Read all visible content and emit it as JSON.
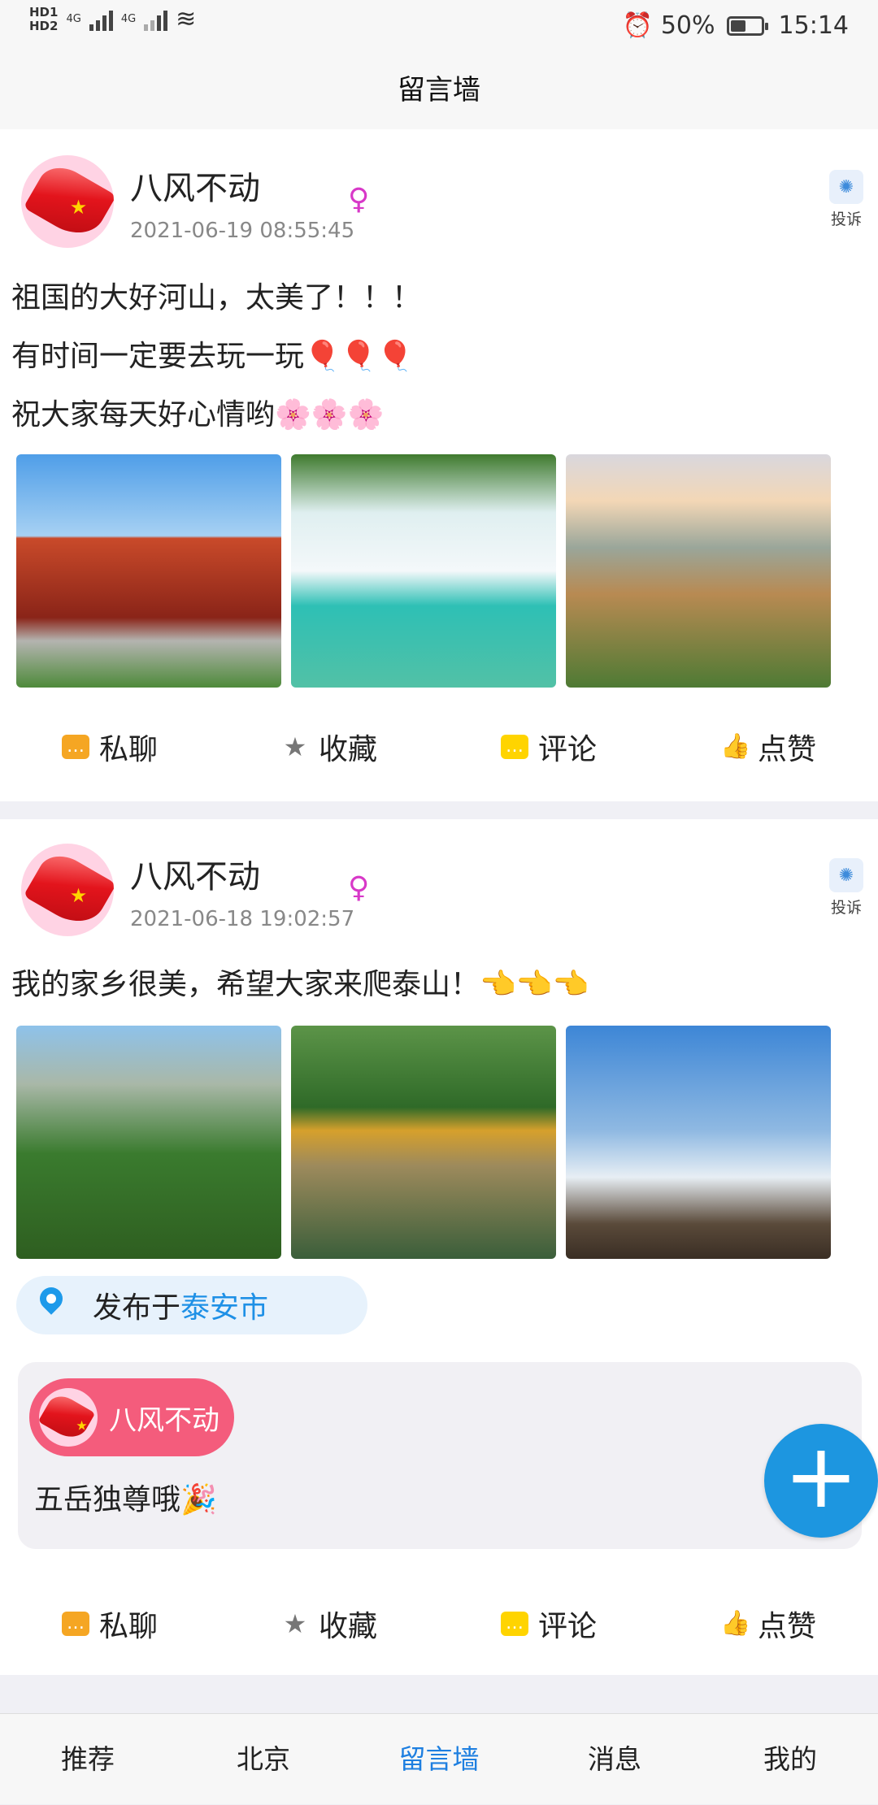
{
  "status_bar": {
    "hd1": "HD1",
    "hd2": "HD2",
    "net": "4G",
    "battery_pct": "50%",
    "time": "15:14"
  },
  "header": {
    "title": "留言墙"
  },
  "posts": [
    {
      "user": "八风不动",
      "time": "2021-06-19 08:55:45",
      "gender_icon": "♀",
      "report_label": "投诉",
      "lines": [
        "祖国的大好河山，太美了！！！",
        "有时间一定要去玩一玩🎈🎈🎈",
        "祝大家每天好心情哟🌸🌸🌸"
      ]
    },
    {
      "user": "八风不动",
      "time": "2021-06-18 19:02:57",
      "gender_icon": "♀",
      "report_label": "投诉",
      "lines": [
        "我的家乡很美，希望大家来爬泰山！👈👈👈"
      ],
      "location_prefix": "发布于",
      "location_city": "泰安市",
      "comment_user": "八风不动",
      "comment_text": "五岳独尊哦🎉"
    }
  ],
  "actions": {
    "chat": "私聊",
    "favorite": "收藏",
    "comment": "评论",
    "like": "点赞"
  },
  "fab": {
    "icon": "+"
  },
  "nav": {
    "items": [
      "推荐",
      "北京",
      "留言墙",
      "消息",
      "我的"
    ],
    "active": 2
  },
  "colors": {
    "accent": "#1e90e6",
    "pill": "#f45c7c",
    "gender": "#d838c8"
  }
}
